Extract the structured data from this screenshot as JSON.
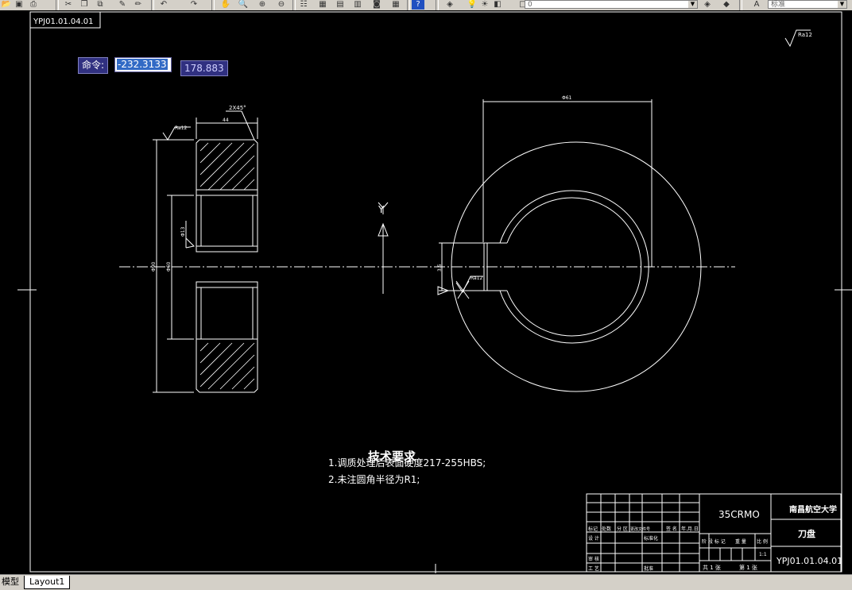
{
  "toolbar": {
    "layer_value": "0",
    "textstyle_value": "标准",
    "icons": [
      "open-icon",
      "save-icon",
      "print-icon",
      "cut-icon",
      "copy-icon",
      "paste-icon",
      "match-icon",
      "undo-icon",
      "redo-icon",
      "pan-icon",
      "zoom-realtime-icon",
      "zoom-window-icon",
      "zoom-previous-icon",
      "properties-icon",
      "designcenter-icon",
      "toolpalette-icon",
      "sheetset-icon",
      "markup-icon",
      "calculator-icon",
      "help-icon",
      "layer-manager-icon",
      "layer-state-icon",
      "textstyle-icon"
    ]
  },
  "command": {
    "label": "命令:",
    "x_value": "-232.3133",
    "y_value": "178.883"
  },
  "drawing": {
    "part_number_mirror": "YPJ01.01.04.01",
    "roughness_top_right": "Ra12",
    "chamfer_note": "2X45°",
    "width_dim": "44",
    "roughness_left": "Ra12",
    "dim_outer": "Φ90",
    "dim_inner": "Φ60",
    "dim_bore": "Φ13",
    "dim_top": "Φ61",
    "dim_keyway": "3.5",
    "roughness_key": "Ra12",
    "axis_label": "Y"
  },
  "requirements": {
    "title": "技术要求",
    "line1": "1.调质处理后表面硬度217-255HBS;",
    "line2": "2.未注圆角半径为R1;"
  },
  "title_block": {
    "material": "35CRMO",
    "school": "南昌航空大学",
    "part_name": "刀盘",
    "drawing_no": "YPJ01.01.04.01",
    "scale": "1:1",
    "row_marks": [
      "标记",
      "处数",
      "分 区",
      "更改文件号",
      "签 名",
      "年.月.日"
    ],
    "design_label": "设 计",
    "standardize_label": "标准化",
    "review_label": "审 核",
    "process_label": "工 艺",
    "approve_label": "批准",
    "stage_labels": [
      "阶 段 标 记",
      "重 量",
      "比 例"
    ],
    "sheet_total": "共 1 张",
    "sheet_no": "第 1 张"
  },
  "tabs": {
    "model": "模型",
    "layout1": "Layout1"
  }
}
